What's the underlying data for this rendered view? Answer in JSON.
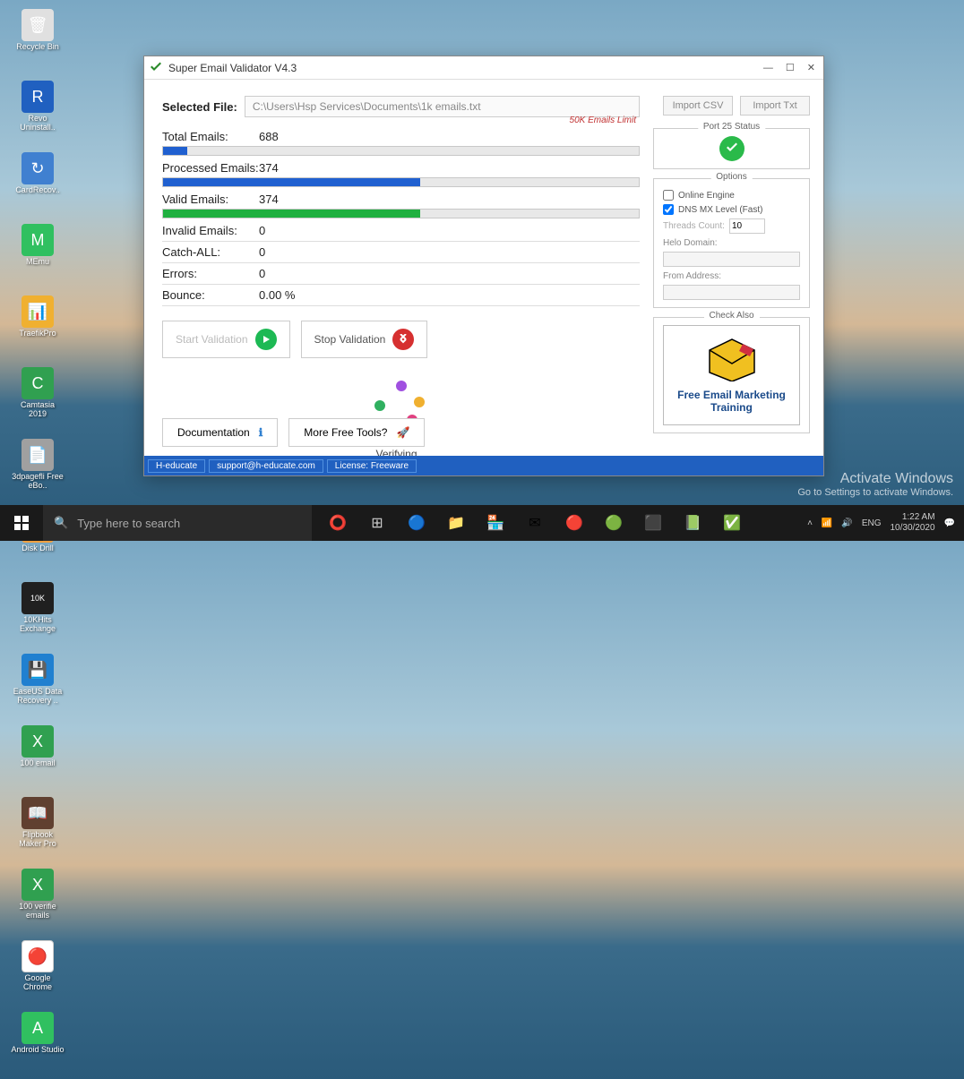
{
  "desktop_icons": [
    {
      "label": "Recycle Bin",
      "color": "#e0e0e0"
    },
    {
      "label": "Revo Uninstall..",
      "color": "#2060c0"
    },
    {
      "label": "CardRecov..",
      "color": "#4080d0"
    },
    {
      "label": "MEmu",
      "color": "#30c060"
    },
    {
      "label": "TraefikPro",
      "color": "#f0b030"
    },
    {
      "label": "Camtasia 2019",
      "color": "#30a050"
    },
    {
      "label": "3dpagefli Free eBo..",
      "color": "#a0a0a0"
    },
    {
      "label": "Disk Drill",
      "color": "#f0a040"
    },
    {
      "label": "10KHits Exchange",
      "color": "#202020"
    },
    {
      "label": "EaseUS Data Recovery ..",
      "color": "#2080d0"
    },
    {
      "label": "100 email",
      "color": "#30a050"
    },
    {
      "label": "Flipbook Maker Pro",
      "color": "#604030"
    },
    {
      "label": "100 verifie emails",
      "color": "#30a050"
    },
    {
      "label": "Google Chrome",
      "color": "#f04030"
    },
    {
      "label": "Android Studio",
      "color": "#30c060"
    }
  ],
  "window": {
    "title": "Super Email Validator V4.3",
    "selected_file_label": "Selected File:",
    "selected_file_value": "C:\\Users\\Hsp Services\\Documents\\1k emails.txt",
    "import_csv": "Import CSV",
    "import_txt": "Import Txt",
    "stats": {
      "total_label": "Total Emails:",
      "total_value": "688",
      "total_percent": 5,
      "total_color": "#2060d0",
      "limit": "50K Emails Limit",
      "processed_label": "Processed Emails:",
      "processed_value": "374",
      "processed_percent": 54,
      "processed_color": "#2060d0",
      "valid_label": "Valid Emails:",
      "valid_value": "374",
      "valid_percent": 54,
      "valid_color": "#20b040",
      "invalid_label": "Invalid Emails:",
      "invalid_value": "0",
      "catchall_label": "Catch-ALL:",
      "catchall_value": "0",
      "errors_label": "Errors:",
      "errors_value": "0",
      "bounce_label": "Bounce:",
      "bounce_value": "0.00 %"
    },
    "start_btn": "Start Validation",
    "stop_btn": "Stop Validation",
    "verifying": "Verifying...",
    "documentation": "Documentation",
    "more_tools": "More Free Tools?",
    "port_status_title": "Port  25 Status",
    "options_title": "Options",
    "online_engine": "Online Engine",
    "dns_mx": "DNS MX Level (Fast)",
    "threads_label": "Threads Count:",
    "threads_value": "10",
    "helo_label": "Helo Domain:",
    "from_label": "From Address:",
    "check_also_title": "Check Also",
    "promo_text": "Free Email Marketing Training",
    "status_items": [
      "H-educate",
      "support@h-educate.com",
      "License: Freeware"
    ]
  },
  "taskbar": {
    "search_placeholder": "Type here to search",
    "lang": "ENG",
    "time": "1:22 AM",
    "date": "10/30/2020"
  },
  "activate": {
    "line1": "Activate Windows",
    "line2": "Go to Settings to activate Windows."
  }
}
